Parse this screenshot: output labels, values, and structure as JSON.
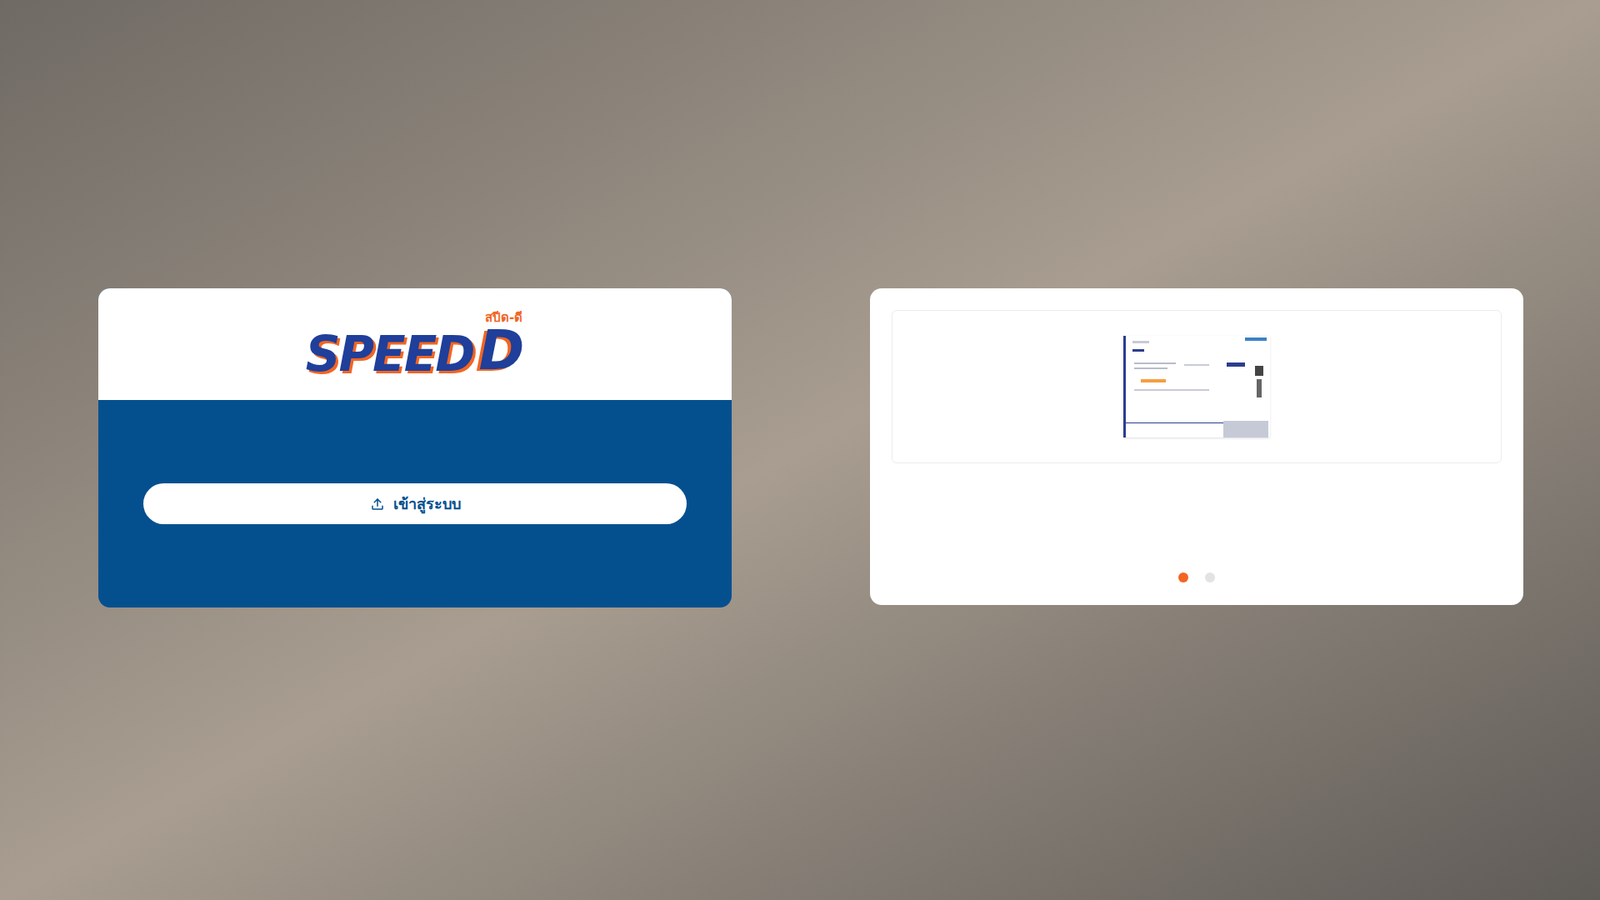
{
  "logo": {
    "text": "SPEED",
    "letter": "D",
    "thai": "สปีด-ดี"
  },
  "login_button": {
    "label": "เข้าสู่ระบบ"
  },
  "carousel": {
    "slides": [
      {
        "selected": true
      },
      {
        "selected": false
      }
    ]
  }
}
